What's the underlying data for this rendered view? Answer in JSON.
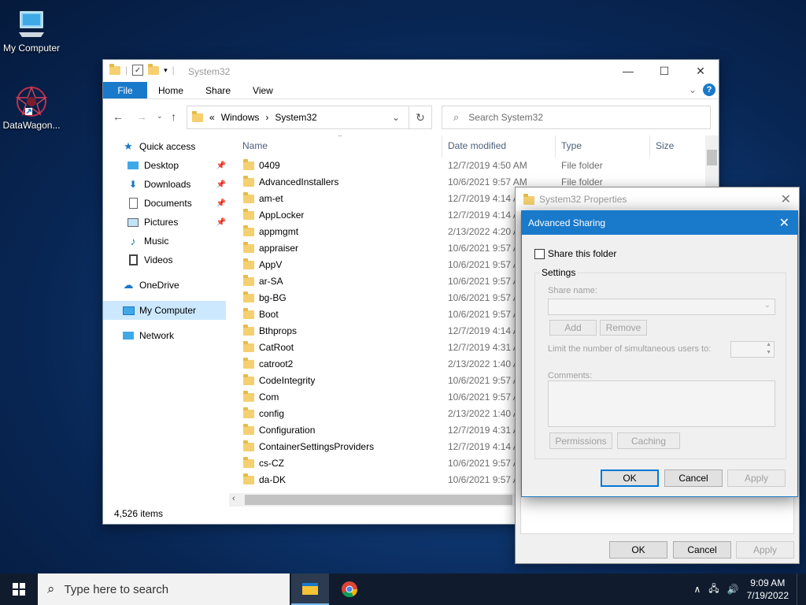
{
  "desktop": {
    "icons": [
      {
        "label": "My Computer"
      },
      {
        "label": "DataWagon..."
      }
    ]
  },
  "explorer": {
    "title": "System32",
    "ribbon": {
      "file": "File",
      "home": "Home",
      "share": "Share",
      "view": "View"
    },
    "address": {
      "overflow": "«",
      "crumb1": "Windows",
      "sep": "›",
      "crumb2": "System32"
    },
    "search_placeholder": "Search System32",
    "nav": {
      "quick_access": "Quick access",
      "desktop": "Desktop",
      "downloads": "Downloads",
      "documents": "Documents",
      "pictures": "Pictures",
      "music": "Music",
      "videos": "Videos",
      "onedrive": "OneDrive",
      "my_computer": "My Computer",
      "network": "Network"
    },
    "columns": {
      "name": "Name",
      "date": "Date modified",
      "type": "Type",
      "size": "Size"
    },
    "rows": [
      {
        "name": "0409",
        "date": "12/7/2019 4:50 AM",
        "type": "File folder"
      },
      {
        "name": "AdvancedInstallers",
        "date": "10/6/2021 9:57 AM",
        "type": "File folder"
      },
      {
        "name": "am-et",
        "date": "12/7/2019 4:14 A",
        "type": ""
      },
      {
        "name": "AppLocker",
        "date": "12/7/2019 4:14 A",
        "type": ""
      },
      {
        "name": "appmgmt",
        "date": "2/13/2022 4:20 A",
        "type": ""
      },
      {
        "name": "appraiser",
        "date": "10/6/2021 9:57 A",
        "type": ""
      },
      {
        "name": "AppV",
        "date": "10/6/2021 9:57 A",
        "type": ""
      },
      {
        "name": "ar-SA",
        "date": "10/6/2021 9:57 A",
        "type": ""
      },
      {
        "name": "bg-BG",
        "date": "10/6/2021 9:57 A",
        "type": ""
      },
      {
        "name": "Boot",
        "date": "10/6/2021 9:57 A",
        "type": ""
      },
      {
        "name": "Bthprops",
        "date": "12/7/2019 4:14 A",
        "type": ""
      },
      {
        "name": "CatRoot",
        "date": "12/7/2019 4:31 A",
        "type": ""
      },
      {
        "name": "catroot2",
        "date": "2/13/2022 1:40 A",
        "type": ""
      },
      {
        "name": "CodeIntegrity",
        "date": "10/6/2021 9:57 A",
        "type": ""
      },
      {
        "name": "Com",
        "date": "10/6/2021 9:57 A",
        "type": ""
      },
      {
        "name": "config",
        "date": "2/13/2022 1:40 A",
        "type": ""
      },
      {
        "name": "Configuration",
        "date": "12/7/2019 4:31 A",
        "type": ""
      },
      {
        "name": "ContainerSettingsProviders",
        "date": "12/7/2019 4:14 A",
        "type": ""
      },
      {
        "name": "cs-CZ",
        "date": "10/6/2021 9:57 A",
        "type": ""
      },
      {
        "name": "da-DK",
        "date": "10/6/2021 9:57 A",
        "type": ""
      }
    ],
    "status": "4,526 items"
  },
  "properties": {
    "title": "System32 Properties",
    "ok": "OK",
    "cancel": "Cancel",
    "apply": "Apply"
  },
  "advanced_sharing": {
    "title": "Advanced Sharing",
    "share_checkbox": "Share this folder",
    "settings_legend": "Settings",
    "share_name_label": "Share name:",
    "add": "Add",
    "remove": "Remove",
    "limit_label": "Limit the number of simultaneous users to:",
    "comments_label": "Comments:",
    "permissions": "Permissions",
    "caching": "Caching",
    "ok": "OK",
    "cancel": "Cancel",
    "apply": "Apply"
  },
  "taskbar": {
    "search_placeholder": "Type here to search",
    "time": "9:09 AM",
    "date": "7/19/2022"
  }
}
